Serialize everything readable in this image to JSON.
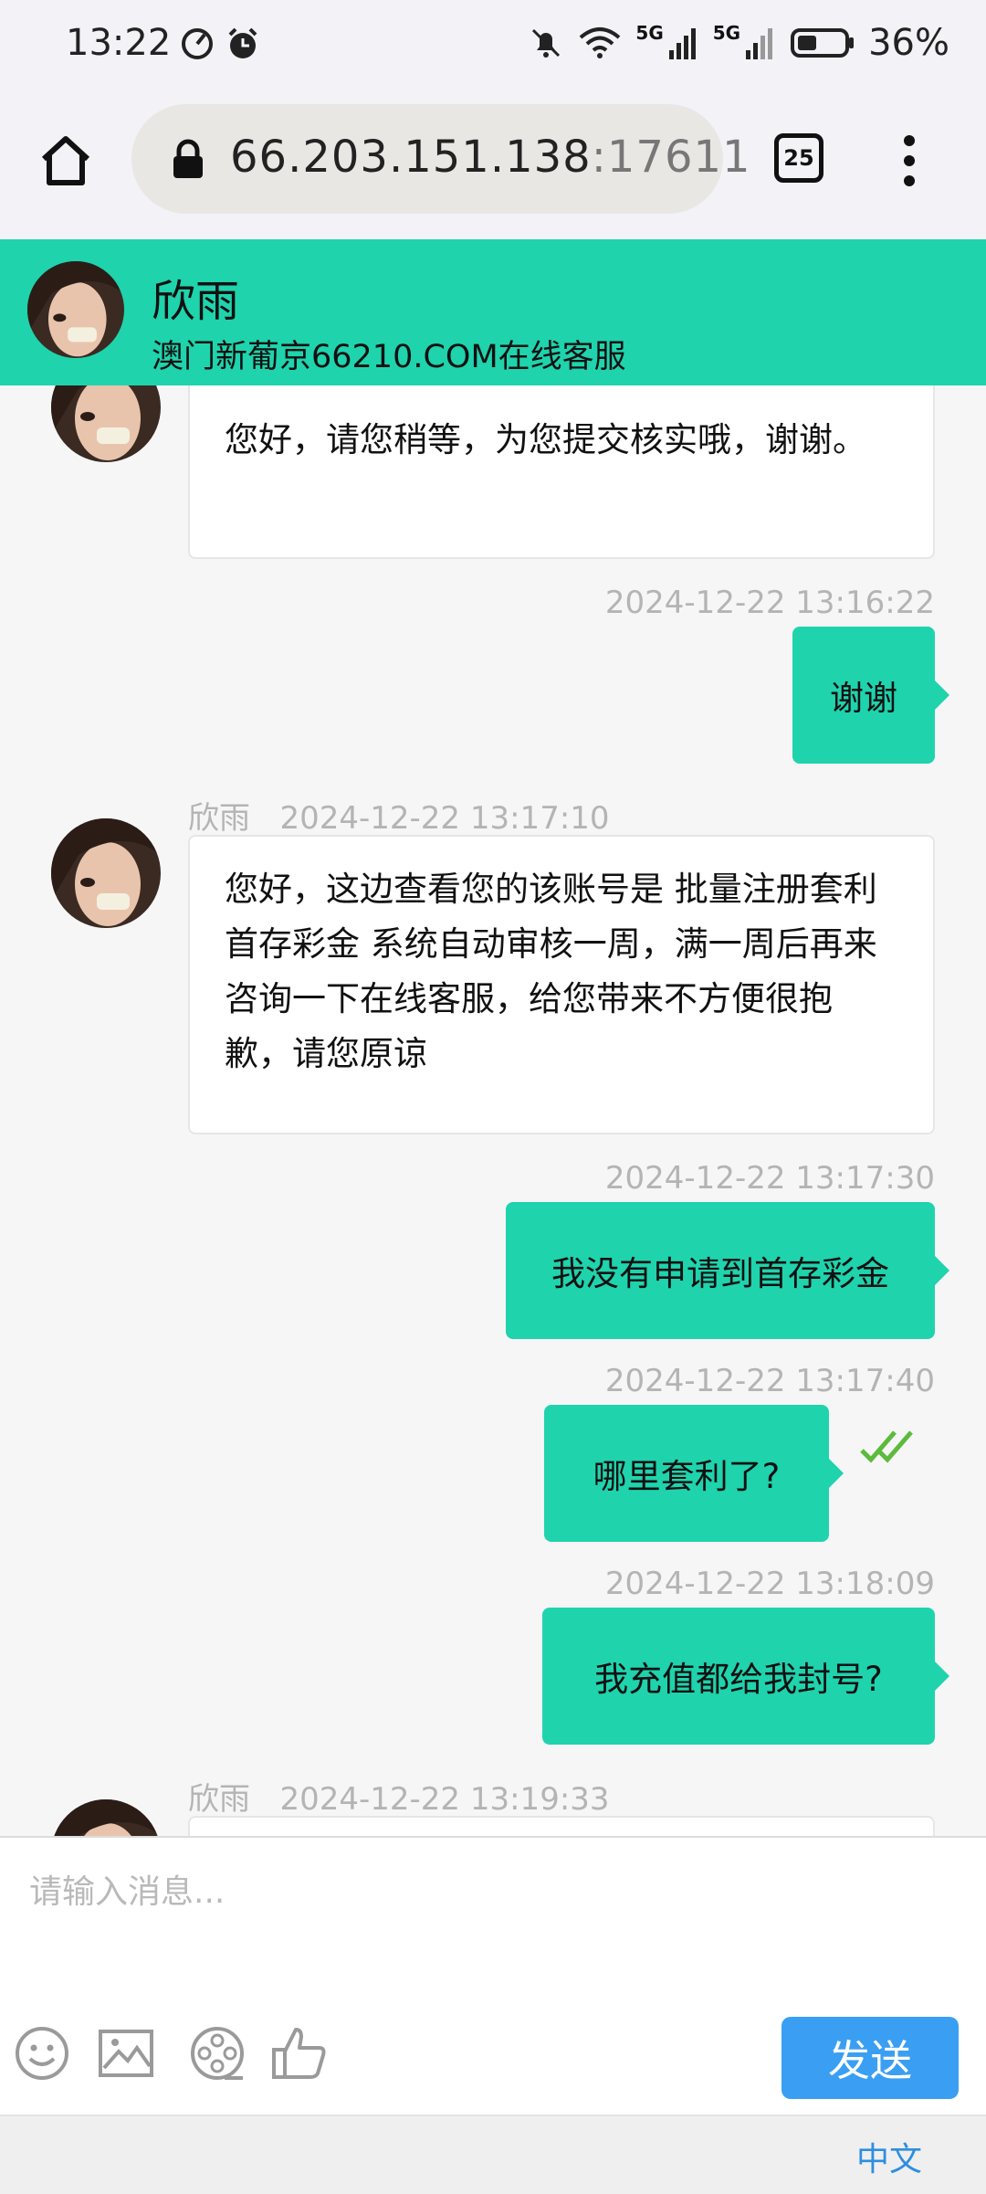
{
  "status_bar": {
    "time": "13:22",
    "battery": "36%",
    "network_1": "5G",
    "network_2": "5G"
  },
  "browser": {
    "url_host": "66.203.151.138",
    "url_port": ":17611",
    "tab_count": "25"
  },
  "chat_header": {
    "agent_name": "欣雨",
    "subtitle": "澳门新葡京66210.COM在线客服"
  },
  "messages": [
    {
      "direction": "in",
      "text": "您好，请您稍等，为您提交核实哦，谢谢。"
    },
    {
      "direction": "out",
      "time": "2024-12-22 13:16:22",
      "text": "谢谢"
    },
    {
      "direction": "in",
      "sender": "欣雨",
      "time": "2024-12-22 13:17:10",
      "text": "您好，这边查看您的该账号是 批量注册套利首存彩金 系统自动审核一周，满一周后再来咨询一下在线客服，给您带来不方便很抱歉，请您原谅"
    },
    {
      "direction": "out",
      "time": "2024-12-22 13:17:30",
      "text": "我没有申请到首存彩金"
    },
    {
      "direction": "out",
      "time": "2024-12-22 13:17:40",
      "text": "哪里套利了?",
      "read": true
    },
    {
      "direction": "out",
      "time": "2024-12-22 13:18:09",
      "text": "我充值都给我封号?"
    },
    {
      "direction": "in",
      "sender": "欣雨",
      "time": "2024-12-22 13:19:33",
      "text": ""
    }
  ],
  "composer": {
    "placeholder": "请输入消息...",
    "tools": [
      "emoji-icon",
      "image-icon",
      "video-icon",
      "thumbs-up-icon"
    ],
    "send_label": "发送"
  },
  "footer": {
    "language": "中文"
  },
  "colors": {
    "accent": "#1fd3ad",
    "send_button": "#3a9ff2",
    "link": "#2e8ee0"
  }
}
